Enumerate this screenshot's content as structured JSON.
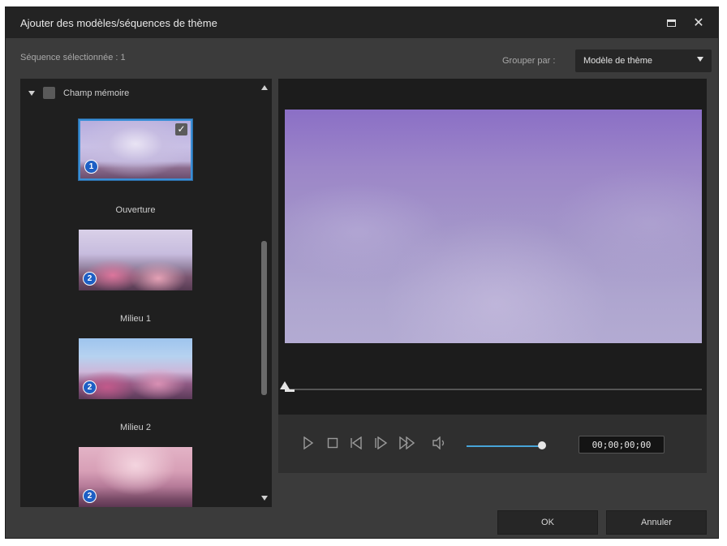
{
  "window": {
    "title": "Ajouter des modèles/séquences de thème",
    "controls": [
      "maximize-icon",
      "close-icon"
    ],
    "close_glyph": "✕"
  },
  "header": {
    "selected_label": "Séquence sélectionnée : 1",
    "group_by_label": "Grouper par :",
    "group_by_value": "Modèle de thème"
  },
  "tree": {
    "group_name": "Champ mémoire",
    "clips": [
      {
        "label": "Ouverture",
        "badge": "1",
        "selected": true,
        "checkmark": "✓"
      },
      {
        "label": "Milieu 1",
        "badge": "2",
        "selected": false
      },
      {
        "label": "Milieu 2",
        "badge": "2",
        "selected": false
      },
      {
        "label": "",
        "badge": "2",
        "selected": false
      }
    ]
  },
  "player": {
    "timecode": "00;00;00;00",
    "volume": 1.0,
    "position": 0.0,
    "icons": [
      "play-icon",
      "stop-icon",
      "prev-frame-icon",
      "next-frame-icon",
      "fast-forward-icon",
      "volume-icon"
    ]
  },
  "footer": {
    "ok_label": "OK",
    "cancel_label": "Annuler"
  },
  "colors": {
    "accent": "#3a8fd6",
    "badge": "#1d5fc4",
    "volume": "#47a4d8"
  }
}
